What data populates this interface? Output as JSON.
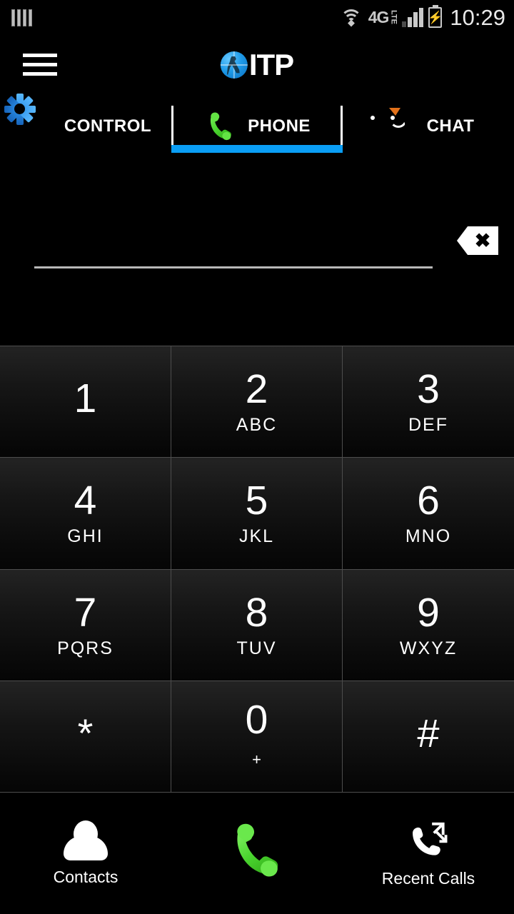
{
  "status_bar": {
    "left_icon": "app-bars-icon",
    "wifi_icon": "wifi-icon",
    "network_label": "4G",
    "network_sublabel": "LTE",
    "signal_icon": "signal-bars-icon",
    "signal_bars_filled": 3,
    "signal_bars_total": 4,
    "battery_icon": "battery-charging-icon",
    "time": "10:29"
  },
  "header": {
    "menu_icon": "hamburger-menu-icon",
    "logo_icon": "itp-globe-logo-icon",
    "brand": "ITP"
  },
  "tabs": {
    "active": "PHONE",
    "items": [
      {
        "label": "CONTROL",
        "icon": "gear-icon",
        "active": false
      },
      {
        "label": "PHONE",
        "icon": "phone-handset-icon",
        "active": true
      },
      {
        "label": "CHAT",
        "icon": "chat-bubble-smiley-icon",
        "active": false
      }
    ],
    "active_indicator_color": "#0a9ef5"
  },
  "dialer": {
    "number_value": "",
    "number_placeholder": "",
    "backspace_icon": "backspace-delete-icon",
    "keys": [
      {
        "digit": "1",
        "letters": ""
      },
      {
        "digit": "2",
        "letters": "ABC"
      },
      {
        "digit": "3",
        "letters": "DEF"
      },
      {
        "digit": "4",
        "letters": "GHI"
      },
      {
        "digit": "5",
        "letters": "JKL"
      },
      {
        "digit": "6",
        "letters": "MNO"
      },
      {
        "digit": "7",
        "letters": "PQRS"
      },
      {
        "digit": "8",
        "letters": "TUV"
      },
      {
        "digit": "9",
        "letters": "WXYZ"
      },
      {
        "digit": "*",
        "letters": ""
      },
      {
        "digit": "0",
        "letters": "+"
      },
      {
        "digit": "#",
        "letters": ""
      }
    ]
  },
  "bottom_bar": {
    "contacts_label": "Contacts",
    "contacts_icon": "contacts-person-icon",
    "call_icon": "call-handset-icon",
    "call_label": "",
    "recent_label": "Recent Calls",
    "recent_icon": "recent-calls-icon"
  },
  "colors": {
    "accent_blue": "#0a9ef5",
    "call_green": "#4bd630",
    "chat_orange": "#e2711a",
    "gear_blue": "#2a8fe8",
    "background": "#000000"
  }
}
